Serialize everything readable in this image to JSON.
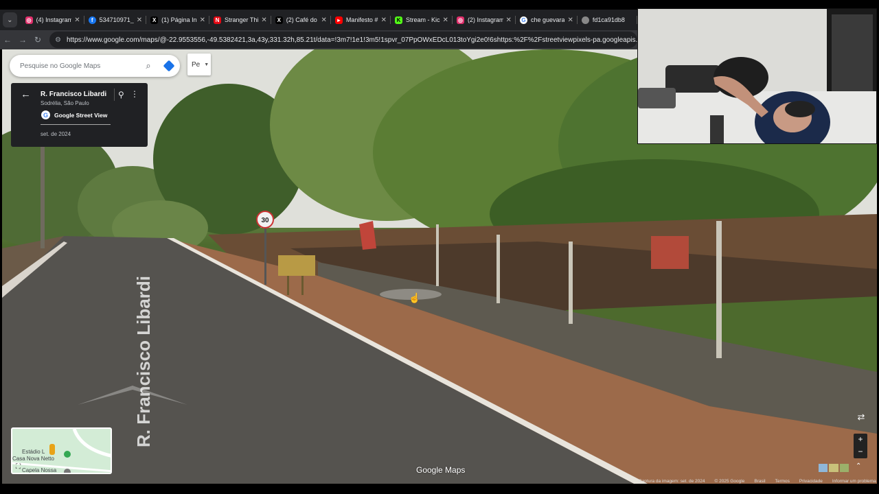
{
  "browser": {
    "tabs": [
      {
        "label": "(4) Instagram",
        "icon": "instagram-icon",
        "color": "#e1306c"
      },
      {
        "label": "534710971_",
        "icon": "facebook-icon",
        "color": "#1877f2"
      },
      {
        "label": "(1) Página In",
        "icon": "x-icon",
        "color": "#000000"
      },
      {
        "label": "Stranger Thi",
        "icon": "netflix-icon",
        "color": "#e50914"
      },
      {
        "label": "(2) Café do",
        "icon": "x-icon",
        "color": "#000000"
      },
      {
        "label": "Manifesto #",
        "icon": "youtube-icon",
        "color": "#ff0000"
      },
      {
        "label": "Stream - Kic",
        "icon": "kick-icon",
        "color": "#53fc18"
      },
      {
        "label": "(2) Instagram",
        "icon": "instagram-icon",
        "color": "#e1306c"
      },
      {
        "label": "che guevara",
        "icon": "google-icon",
        "color": "#4285f4"
      },
      {
        "label": "fd1ca91db8",
        "icon": "globe-icon",
        "color": "#888888"
      }
    ],
    "url": "https://www.google.com/maps/@-22.9553556,-49.5382421,3a,43y,331.32h,85.21t/data=!3m7!1e1!3m5!1spvr_07PpOWxEDcL013toYgi2e0!6shttps:%2F%2Fstreetviewpixels-pa.googleapis.com%2Fv1%2Ft"
  },
  "maps": {
    "search_placeholder": "Pesquise no Google Maps",
    "layer_label": "Pe",
    "street_name": "R. Francisco Libardi",
    "city": "Sodrélia, São Paulo",
    "provider": "Google Street View",
    "capture_date": "set. de 2024",
    "road_label": "R. Francisco Libardi",
    "speed_sign": "30",
    "watermark": "Google Maps",
    "minimap": {
      "label_1": "Estádio L",
      "label_2": "Casa Nova Netto",
      "label_3": "Capela Nossa"
    },
    "footer": {
      "capture": "Captura da imagem: set. de 2024",
      "copyright": "© 2025 Google",
      "country": "Brasil",
      "terms": "Termos",
      "privacy": "Privacidade",
      "report": "Informar um problema"
    },
    "zoom_in": "+",
    "zoom_out": "−"
  }
}
